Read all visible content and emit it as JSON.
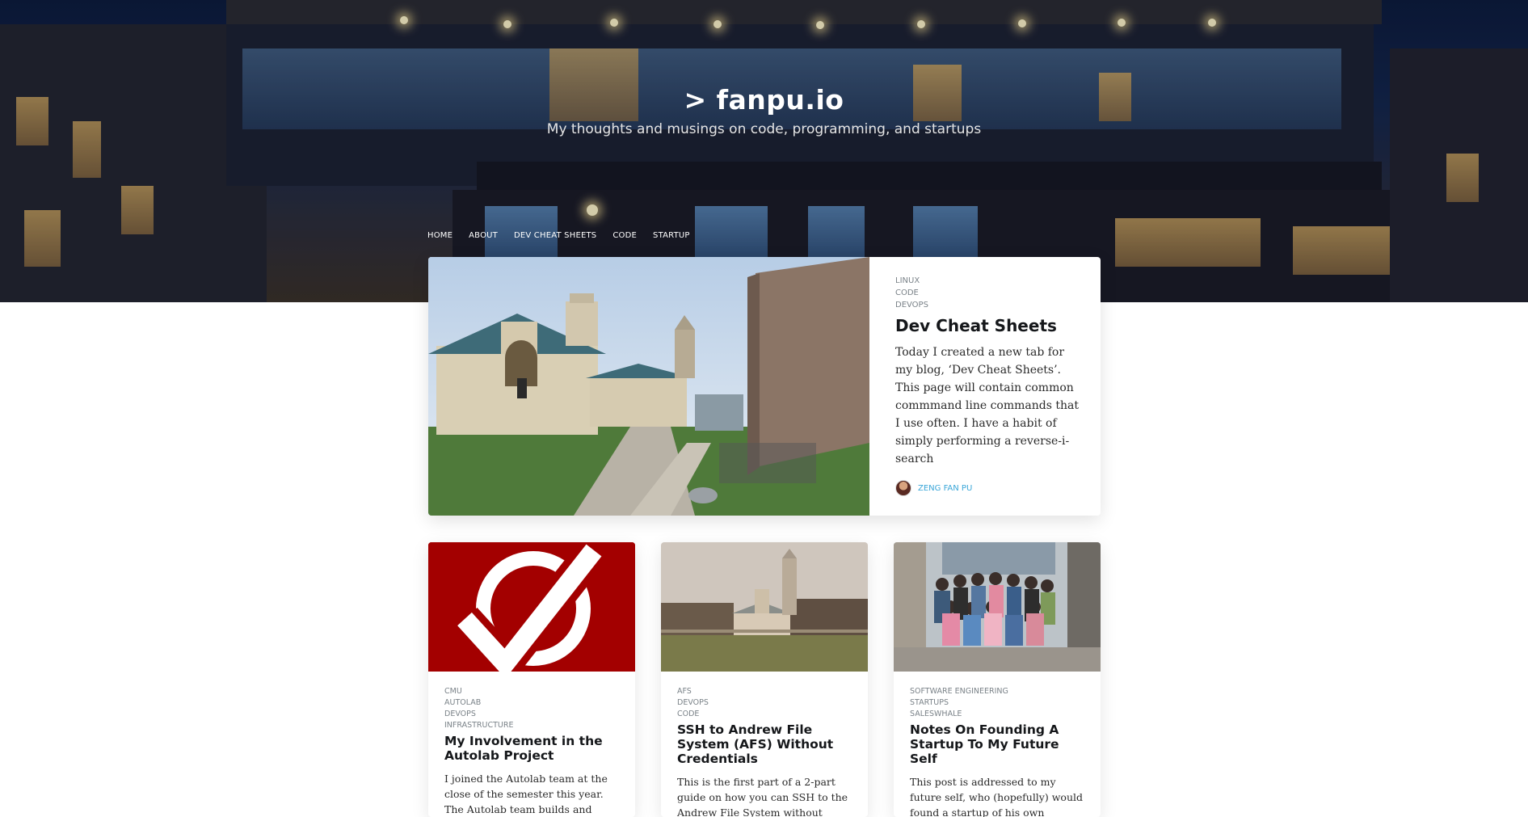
{
  "site": {
    "title": "> fanpu.io",
    "description": "My thoughts and musings on code, programming, and startups"
  },
  "nav": [
    "HOME",
    "ABOUT",
    "DEV CHEAT SHEETS",
    "CODE",
    "STARTUP"
  ],
  "featured": {
    "tags": [
      "LINUX",
      "CODE",
      "DEVOPS"
    ],
    "title": "Dev Cheat Sheets",
    "excerpt": "Today I created a new tab for my blog, ‘Dev Cheat Sheets’. This page will contain common commmand line commands that I use often. I have a habit of simply performing a reverse-i-search",
    "author": "ZENG FAN PU"
  },
  "cards": [
    {
      "tags": [
        "CMU",
        "AUTOLAB",
        "DEVOPS",
        "INFRASTRUCTURE"
      ],
      "title": "My Involvement in the Autolab Project",
      "excerpt": "I joined the Autolab team at the close of the semester this year. The Autolab team builds and maintains"
    },
    {
      "tags": [
        "AFS",
        "DEVOPS",
        "CODE"
      ],
      "title": "SSH to Andrew File System (AFS) Without Credentials",
      "excerpt": "This is the first part of a 2-part guide on how you can SSH to the Andrew File System without having to enter your password"
    },
    {
      "tags": [
        "SOFTWARE ENGINEERING",
        "STARTUPS",
        "SALESWHALE"
      ],
      "title": "Notes On Founding A Startup To My Future Self",
      "excerpt": "This post is addressed to my future self, who (hopefully) would found a startup of his own someday. This is"
    }
  ],
  "colors": {
    "accent": "#3aa6d8",
    "autolab_red": "#a30000"
  }
}
